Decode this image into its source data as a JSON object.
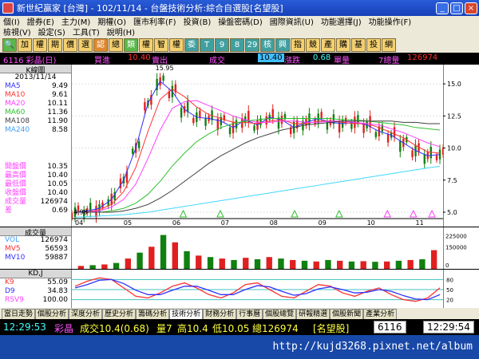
{
  "window": {
    "title": "新世紀贏家 [台灣] - 102/11/14 - 台盤技術分析:綜合自選股[名望股]"
  },
  "menubar": {
    "row1": [
      "個(I)",
      "證券(E)",
      "主力(M)",
      "期權(O)",
      "匯市利率(F)",
      "投資(B)",
      "操盤密碼(D)",
      "國際資訊(U)",
      "功能選擇(J)",
      "功能操作(F)"
    ],
    "row2": [
      "檢視(V)",
      "設定(S)",
      "工具(T)",
      "說明(H)"
    ]
  },
  "toolbar": {
    "buttons": [
      "加",
      "權",
      "期",
      "價",
      "選",
      "認",
      "總",
      "類",
      "權",
      "智",
      "權",
      "委",
      "T",
      "9",
      "8",
      "29",
      "核",
      "興",
      "指",
      "競",
      "產",
      "購",
      "基",
      "投",
      "網"
    ]
  },
  "infostrip": {
    "code": "6116 彩晶(日)",
    "bid_label": "買進",
    "bid_value": "10.40",
    "ask_label": "賣出",
    "trade_label": "成交",
    "trade_value": "10.40",
    "change_label": "漲跌",
    "change_value": "0.68",
    "vol_label": "單量",
    "total_label": "7總量",
    "total_value": "126974"
  },
  "leftpanel": {
    "header": "K線圖",
    "date": "2013/11/14",
    "ma": [
      {
        "label": "MA5",
        "value": "9.49"
      },
      {
        "label": "MA10",
        "value": "9.61"
      },
      {
        "label": "MA20",
        "value": "10.11"
      },
      {
        "label": "MA60",
        "value": "11.36"
      },
      {
        "label": "MA108",
        "value": "11.90"
      },
      {
        "label": "MA240",
        "value": "8.58"
      }
    ],
    "prices": [
      {
        "label": "開盤價",
        "value": "10.35"
      },
      {
        "label": "最高價",
        "value": "10.40"
      },
      {
        "label": "最低價",
        "value": "10.05"
      },
      {
        "label": "收盤價",
        "value": "10.40"
      },
      {
        "label": "成交量",
        "value": "126974"
      },
      {
        "label": "差",
        "value": "0.69"
      }
    ]
  },
  "volpanel": {
    "header": "成交量",
    "rows": [
      {
        "label": "VOL",
        "value": "126974"
      },
      {
        "label": "MV5",
        "value": "56593"
      },
      {
        "label": "MV10",
        "value": "59887"
      }
    ]
  },
  "kdpanel": {
    "header": "KD,J",
    "rows": [
      {
        "label": "K9",
        "value": "55.09"
      },
      {
        "label": "D9",
        "value": "34.83"
      },
      {
        "label": "RSV9",
        "value": "100.00"
      }
    ]
  },
  "chart_data": [
    {
      "type": "line",
      "panel": "K-line price chart",
      "x_tick_labels": [
        "04",
        "05",
        "06",
        "07",
        "08",
        "09",
        "10",
        "11"
      ],
      "y_tick_labels": [
        "15.0",
        "12.5",
        "10.0",
        "7.5",
        "5.0"
      ],
      "ylim": [
        4.5,
        16.5
      ],
      "annotations": [
        "15.95",
        "4.98"
      ],
      "series": [
        {
          "name": "MA5",
          "color": "#3030ff",
          "values": [
            5.0,
            5.1,
            5.3,
            6.0,
            7.5,
            10.0,
            13.5,
            15.2,
            14.4,
            13.0,
            12.4,
            12.3,
            12.1,
            11.6,
            12.2,
            11.8,
            12.4,
            12.2,
            11.6,
            12.0,
            12.3,
            12.0,
            11.9,
            12.0,
            11.8,
            11.3,
            11.0,
            10.4,
            9.8,
            9.4,
            9.5
          ]
        },
        {
          "name": "MA10",
          "color": "#ff3030",
          "values": [
            5.0,
            5.0,
            5.2,
            5.6,
            6.6,
            8.5,
            11.3,
            13.8,
            14.6,
            14.0,
            13.2,
            12.6,
            12.3,
            12.0,
            12.0,
            11.9,
            12.1,
            12.2,
            11.9,
            11.9,
            12.1,
            12.1,
            12.0,
            11.9,
            11.9,
            11.6,
            11.2,
            10.8,
            10.2,
            9.7,
            9.6
          ]
        },
        {
          "name": "MA20",
          "color": "#ff40ff",
          "values": [
            5.0,
            5.0,
            5.1,
            5.4,
            6.0,
            7.2,
            9.2,
            11.4,
            13.1,
            13.6,
            13.7,
            13.3,
            12.9,
            12.5,
            12.2,
            12.0,
            12.0,
            12.1,
            12.1,
            12.0,
            12.0,
            12.1,
            12.1,
            12.0,
            11.9,
            11.8,
            11.5,
            11.2,
            10.8,
            10.4,
            10.1
          ]
        },
        {
          "name": "MA60",
          "color": "#30c030",
          "values": [
            5.0,
            5.0,
            5.0,
            5.1,
            5.3,
            5.7,
            6.4,
            7.4,
            8.6,
            9.6,
            10.5,
            11.1,
            11.6,
            11.9,
            12.1,
            12.2,
            12.3,
            12.3,
            12.3,
            12.3,
            12.3,
            12.3,
            12.2,
            12.2,
            12.1,
            12.0,
            11.9,
            11.8,
            11.6,
            11.5,
            11.4
          ]
        },
        {
          "name": "MA108",
          "color": "#404040",
          "values": [
            5.0,
            5.0,
            5.0,
            5.0,
            5.1,
            5.3,
            5.6,
            6.1,
            6.7,
            7.4,
            8.1,
            8.8,
            9.4,
            9.9,
            10.4,
            10.8,
            11.1,
            11.4,
            11.6,
            11.8,
            11.9,
            12.0,
            12.1,
            12.1,
            12.1,
            12.1,
            12.1,
            12.0,
            12.0,
            11.9,
            11.9
          ]
        },
        {
          "name": "MA240",
          "color": "#40d8ff",
          "values": [
            4.6,
            4.65,
            4.7,
            4.75,
            4.8,
            4.9,
            5.0,
            5.15,
            5.3,
            5.45,
            5.6,
            5.75,
            5.9,
            6.05,
            6.2,
            6.35,
            6.5,
            6.65,
            6.8,
            6.95,
            7.1,
            7.25,
            7.4,
            7.55,
            7.7,
            7.85,
            8.0,
            8.15,
            8.3,
            8.45,
            8.58
          ]
        }
      ]
    },
    {
      "type": "bar",
      "panel": "Volume",
      "y_tick_labels": [
        "225000",
        "150000",
        "0"
      ],
      "ylim": [
        0,
        260000
      ],
      "values": [
        20000,
        25000,
        30000,
        40000,
        70000,
        110000,
        150000,
        230000,
        180000,
        120000,
        90000,
        80000,
        70000,
        60000,
        75000,
        65000,
        80000,
        70000,
        60000,
        55000,
        50000,
        60000,
        55000,
        50000,
        52000,
        48000,
        50000,
        55000,
        60000,
        65000,
        126974
      ]
    },
    {
      "type": "line",
      "panel": "KD",
      "y_tick_labels": [
        "80",
        "50",
        "20"
      ],
      "ylim": [
        0,
        100
      ],
      "series": [
        {
          "name": "K9",
          "color": "#ff3030",
          "values": [
            60,
            75,
            85,
            80,
            55,
            30,
            25,
            40,
            60,
            70,
            55,
            35,
            25,
            40,
            65,
            70,
            50,
            30,
            25,
            45,
            65,
            60,
            40,
            30,
            45,
            55,
            35,
            20,
            15,
            25,
            55
          ]
        },
        {
          "name": "D9",
          "color": "#3030ff",
          "values": [
            55,
            65,
            78,
            80,
            68,
            48,
            35,
            35,
            48,
            60,
            60,
            48,
            35,
            35,
            50,
            62,
            58,
            45,
            33,
            38,
            52,
            58,
            50,
            40,
            42,
            50,
            45,
            32,
            22,
            20,
            35
          ]
        }
      ]
    }
  ],
  "tabs": [
    "當日走勢",
    "個股分析",
    "深度分析",
    "歷史分析",
    "籌碼分析",
    "技術分析",
    "財務分析",
    "行事曆",
    "個股總覽",
    "研報精選",
    "個股新聞",
    "產業分析"
  ],
  "active_tab": "技術分析",
  "ticker": {
    "time": "12:29:53",
    "name": "彩晶",
    "trade": "成交10.4(0.68)",
    "vol": "量7",
    "high": "高10.4",
    "low": "低10.05",
    "total": "總126974",
    "group": "[名望股]",
    "code": "6116",
    "clock": "12:29:54"
  },
  "statusbar": {
    "url": "http://kujd3268.pixnet.net/album"
  },
  "colors": {
    "title_bg": "#1c4ac8",
    "status_bg": "#1848a8"
  }
}
